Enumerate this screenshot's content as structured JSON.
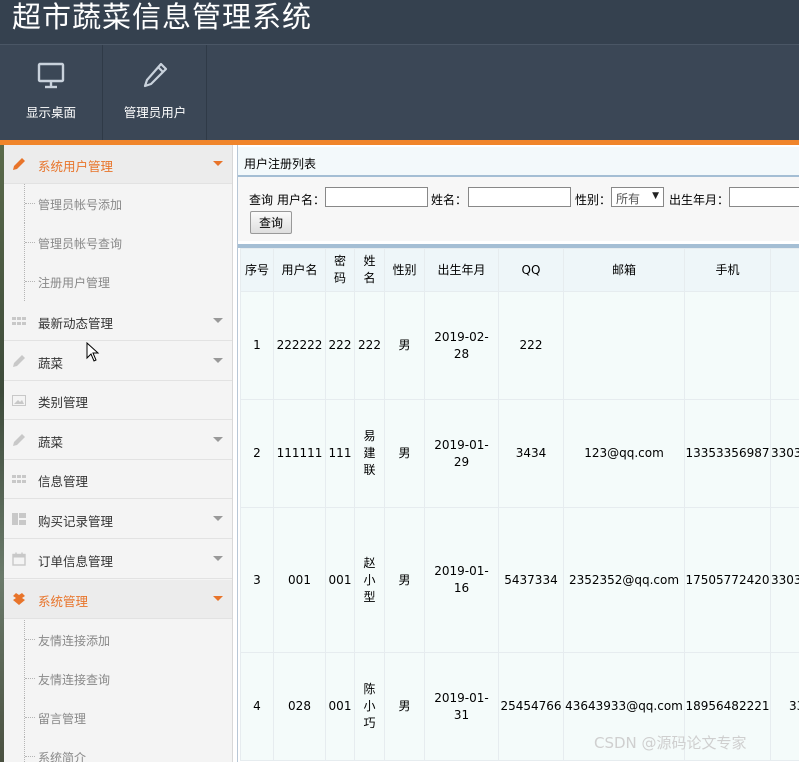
{
  "app": {
    "title": "超市蔬菜信息管理系统"
  },
  "toolbar": {
    "items": [
      {
        "label": "显示桌面",
        "icon": "monitor-icon"
      },
      {
        "label": "管理员用户",
        "icon": "pencil-icon"
      }
    ]
  },
  "sidebar": {
    "items": [
      {
        "type": "head",
        "label": "系统用户管理",
        "icon": "pencil-icon",
        "active": true
      },
      {
        "type": "sub",
        "label": "管理员帐号添加"
      },
      {
        "type": "sub",
        "label": "管理员帐号查询"
      },
      {
        "type": "sub",
        "label": "注册用户管理"
      },
      {
        "type": "head",
        "label": "最新动态管理",
        "icon": "grid-icon"
      },
      {
        "type": "head",
        "label": "蔬菜",
        "icon": "pencil-icon"
      },
      {
        "type": "plain",
        "label": "类别管理",
        "icon": "image-icon"
      },
      {
        "type": "head",
        "label": "蔬菜",
        "icon": "pencil-icon"
      },
      {
        "type": "plain",
        "label": "信息管理",
        "icon": "grid-icon"
      },
      {
        "type": "head",
        "label": "购买记录管理",
        "icon": "layout-icon"
      },
      {
        "type": "head",
        "label": "订单信息管理",
        "icon": "calendar-icon"
      },
      {
        "type": "head",
        "label": "系统管理",
        "icon": "box-icon",
        "active": true
      },
      {
        "type": "sub",
        "label": "友情连接添加"
      },
      {
        "type": "sub",
        "label": "友情连接查询"
      },
      {
        "type": "sub",
        "label": "留言管理"
      },
      {
        "type": "sub",
        "label": "系统简介"
      }
    ]
  },
  "panel": {
    "title": "用户注册列表"
  },
  "search": {
    "query_label": "查询",
    "username_label": "用户名：",
    "name_label": "姓名：",
    "gender_label": "性别：",
    "gender_value": "所有",
    "birth_label": "出生年月：",
    "button_label": "查询"
  },
  "table": {
    "headers": [
      "序号",
      "用户名",
      "密码",
      "姓名",
      "性别",
      "出生年月",
      "QQ",
      "邮箱",
      "手机",
      ""
    ],
    "rows": [
      [
        "1",
        "222222",
        "222",
        "222",
        "男",
        "2019-02-28",
        "222",
        "",
        "",
        ""
      ],
      [
        "2",
        "111111",
        "111",
        "易建联",
        "男",
        "2019-01-29",
        "3434",
        "123@qq.com",
        "13353356987",
        "3303"
      ],
      [
        "3",
        "001",
        "001",
        "赵小型",
        "男",
        "2019-01-16",
        "5437334",
        "2352352@qq.com",
        "17505772420",
        "3303"
      ],
      [
        "4",
        "028",
        "001",
        "陈小巧",
        "男",
        "2019-01-31",
        "25454766",
        "43643933@qq.com",
        "18956482221",
        "33"
      ]
    ]
  },
  "watermark": "CSDN @源码论文专家",
  "colors": {
    "accent": "#f0852b",
    "header_bg": "#35414f",
    "toolbar_bg": "#3b4756",
    "active_text": "#e8742a"
  }
}
